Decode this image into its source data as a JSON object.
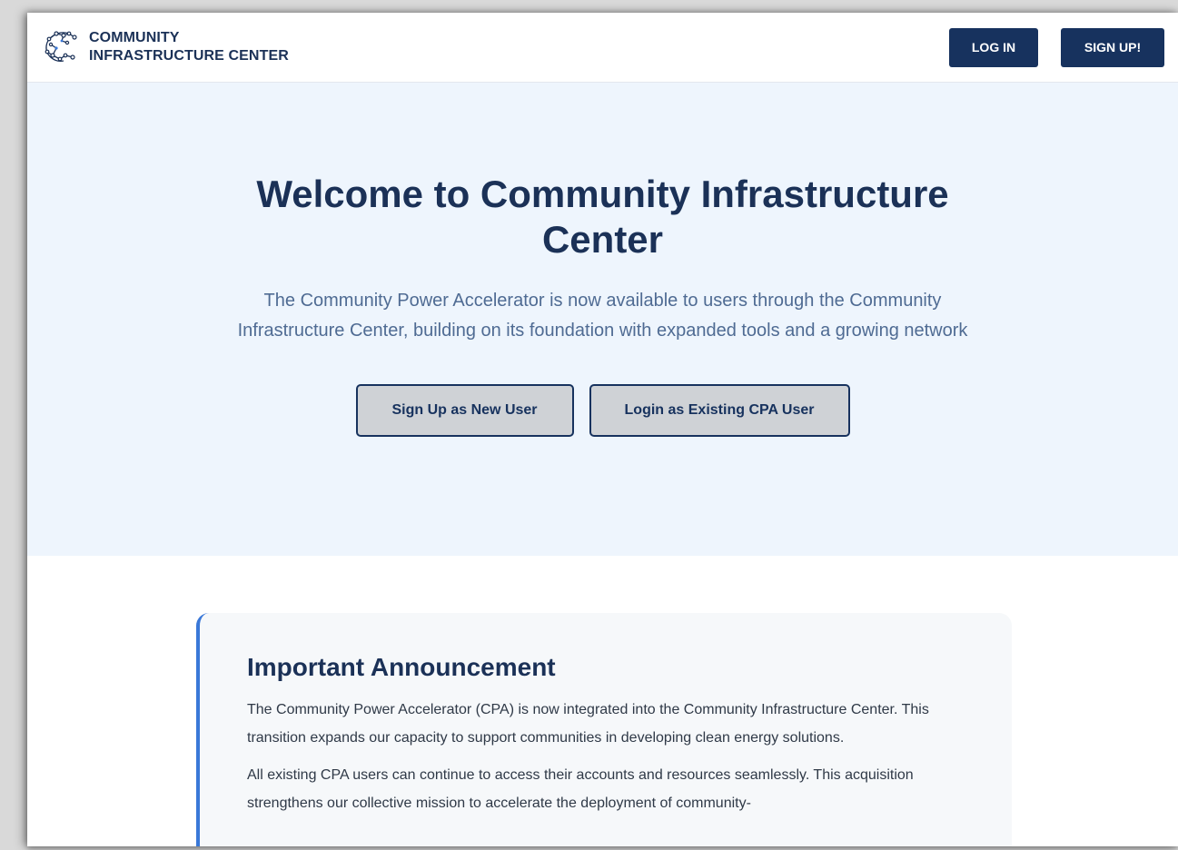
{
  "header": {
    "brand_line1": "COMMUNITY",
    "brand_line2": "INFRASTRUCTURE CENTER",
    "login_label": "LOG IN",
    "signup_label": "SIGN UP!"
  },
  "hero": {
    "title": "Welcome to Community Infrastructure Center",
    "subtitle": "The Community Power Accelerator is now available to users through the Community Infrastructure Center, building on its foundation with expanded tools and a growing network",
    "signup_button": "Sign Up as New User",
    "login_button": "Login as Existing CPA User"
  },
  "announcement": {
    "title": "Important Announcement",
    "paragraph1": "The Community Power Accelerator (CPA) is now integrated into the Community Infrastructure Center. This transition expands our capacity to support communities in developing clean energy solutions.",
    "paragraph2": "All existing CPA users can continue to access their accounts and resources seamlessly. This acquisition strengthens our collective mission to accelerate the deployment of community-"
  },
  "colors": {
    "navy": "#17325e",
    "hero_bg": "#eef5fd",
    "accent": "#3a78d8"
  }
}
